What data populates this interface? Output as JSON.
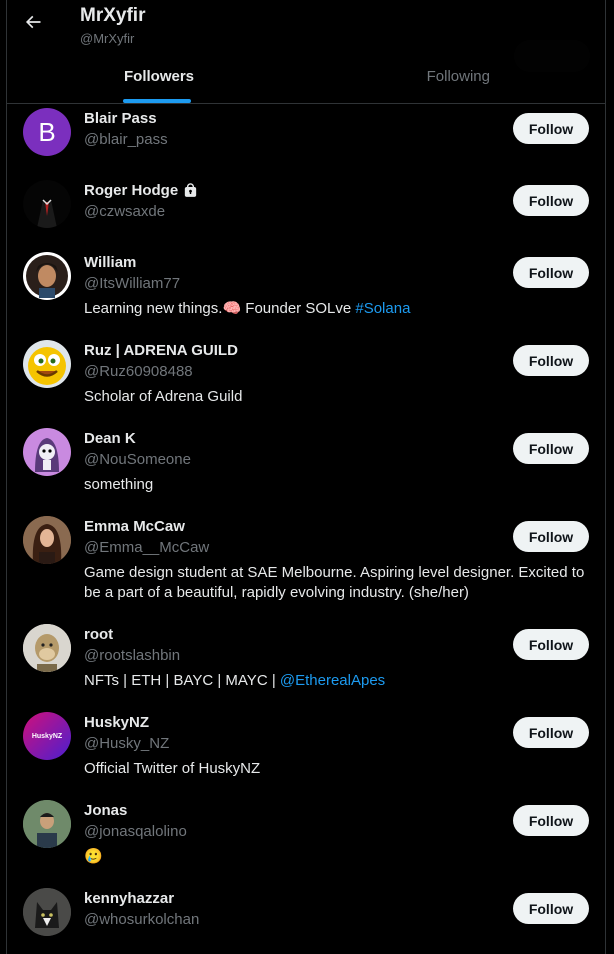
{
  "header": {
    "title": "MrXyfir",
    "handle": "@MrXyfir",
    "tabs": [
      {
        "label": "Followers",
        "active": true
      },
      {
        "label": "Following",
        "active": false
      }
    ]
  },
  "colors": {
    "accent": "#1d9bf0",
    "background": "#000000",
    "muted": "#71767b"
  },
  "users": [
    {
      "name": "Blair Pass",
      "handle": "@blair_pass",
      "bio": "",
      "avatar": "letter-B",
      "button": "Follow"
    },
    {
      "name": "Roger Hodge",
      "handle": "@czwsaxde",
      "bio": "",
      "avatar": "suit-photo",
      "protected": true,
      "button": "Follow"
    },
    {
      "name": "William",
      "handle": "@ItsWilliam77",
      "bio": "Learning new things.",
      "bio_emoji": "🧠",
      "bio_after": " Founder SOLve ",
      "bio_link": "#Solana",
      "avatar": "cartoon-portrait",
      "button": "Follow"
    },
    {
      "name": "Ruz | ADRENA GUILD",
      "handle": "@Ruz60908488",
      "bio": "Scholar of Adrena Guild",
      "avatar": "yellow-smiley",
      "button": "Follow"
    },
    {
      "name": "Dean K",
      "handle": "@NouSomeone",
      "bio": "something",
      "avatar": "purple-ghost",
      "button": "Follow"
    },
    {
      "name": "Emma McCaw",
      "handle": "@Emma__McCaw",
      "bio": "Game design student at SAE Melbourne. Aspiring level designer. Excited to be a part of a beautiful, rapidly evolving industry. (she/her)",
      "avatar": "woman-photo",
      "button": "Follow"
    },
    {
      "name": "root",
      "handle": "@rootslashbin",
      "bio": "NFTs | ETH | BAYC | MAYC | ",
      "bio_link": "@EtherealApes",
      "avatar": "ape-nft",
      "button": "Follow"
    },
    {
      "name": "HuskyNZ",
      "handle": "@Husky_NZ",
      "bio": "Official Twitter of HuskyNZ",
      "avatar": "husky-logo",
      "avatar_text": "HuskyNZ",
      "button": "Follow"
    },
    {
      "name": "Jonas",
      "handle": "@jonasqalolino",
      "bio": "",
      "bio_emoji": "🥲",
      "avatar": "man-photo",
      "button": "Follow"
    },
    {
      "name": "kennyhazzar",
      "handle": "@whosurkolchan",
      "bio": "",
      "avatar": "cat-photo",
      "button": "Follow"
    }
  ]
}
